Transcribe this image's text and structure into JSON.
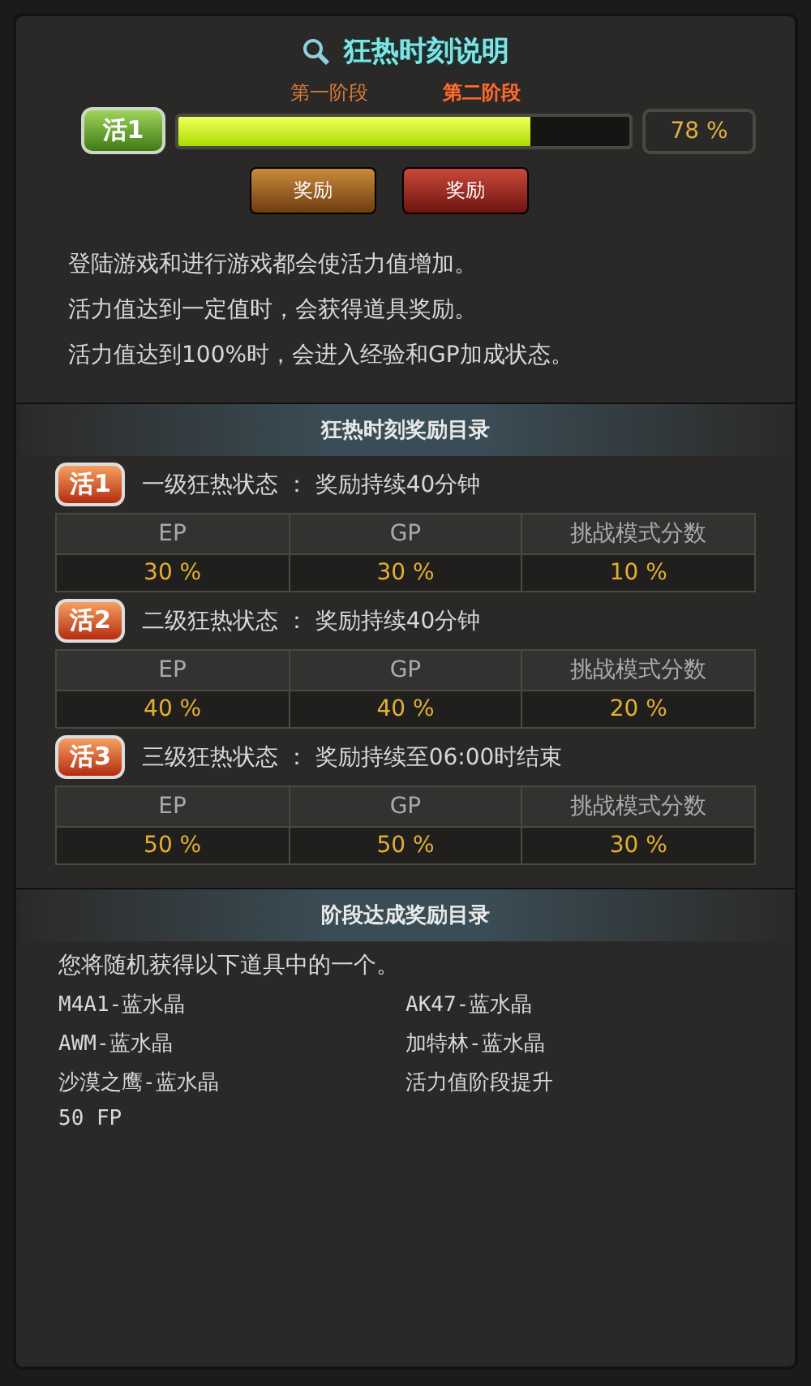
{
  "title": "狂热时刻说明",
  "meter": {
    "badge": "活1",
    "level": 0.78,
    "reading": "78 %"
  },
  "stages": [
    {
      "label": "第一阶段",
      "button": "奖励",
      "selected": false
    },
    {
      "label": "第二阶段",
      "button": "奖励",
      "selected": true
    }
  ],
  "description": [
    "登陆游戏和进行游戏都会使活力值增加。",
    "活力值达到一定值时，会获得道具奖励。",
    "活力值达到100%时，会进入经验和GP加成状态。"
  ],
  "tiers_heading": "狂热时刻奖励目录",
  "tiers": [
    {
      "badge": "活1",
      "title": "一级狂热状态 ： 奖励持续40分钟",
      "columns": [
        "EP",
        "GP",
        "挑战模式分数"
      ],
      "values": [
        "30 %",
        "30 %",
        "10 %"
      ]
    },
    {
      "badge": "活2",
      "title": "二级狂热状态 ： 奖励持续40分钟",
      "columns": [
        "EP",
        "GP",
        "挑战模式分数"
      ],
      "values": [
        "40 %",
        "40 %",
        "20 %"
      ]
    },
    {
      "badge": "活3",
      "title": "三级狂热状态 ： 奖励持续至06:00时结束",
      "columns": [
        "EP",
        "GP",
        "挑战模式分数"
      ],
      "values": [
        "50 %",
        "50 %",
        "30 %"
      ]
    }
  ],
  "rewards_heading": "阶段达成奖励目录",
  "rewards_intro": "您将随机获得以下道具中的一个。",
  "rewards": [
    "M4A1-蓝水晶",
    "AK47-蓝水晶",
    "AWM-蓝水晶",
    "加特林-蓝水晶",
    "沙漠之鹰-蓝水晶",
    "活力值阶段提升",
    "50 FP"
  ]
}
